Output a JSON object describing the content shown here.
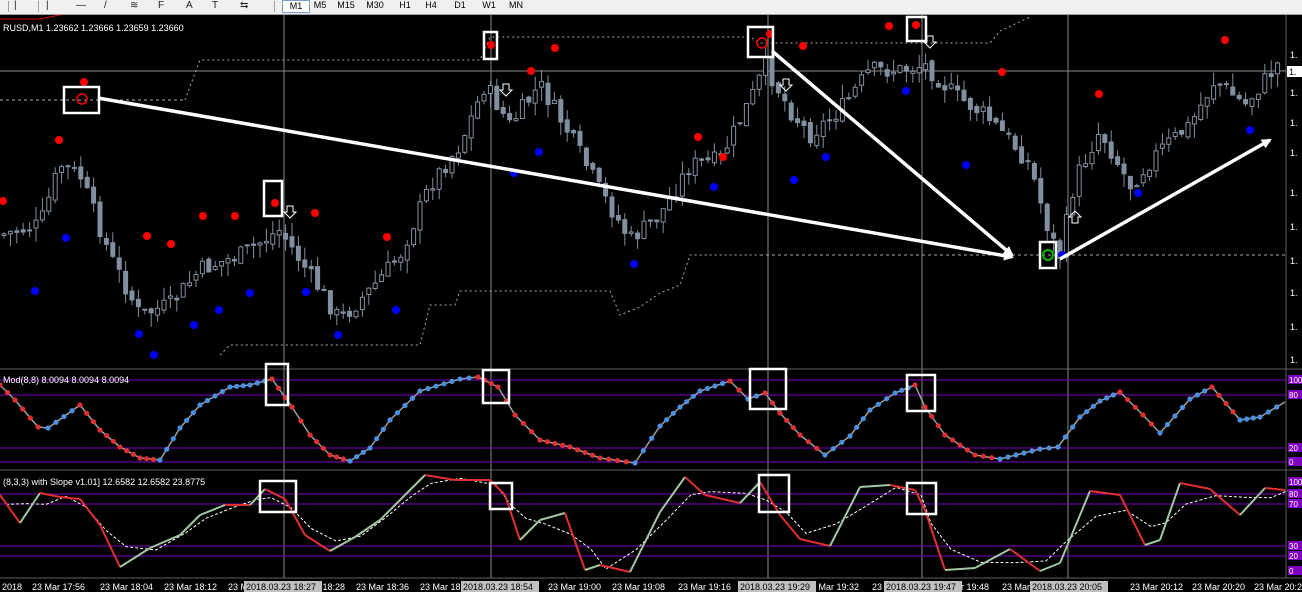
{
  "toolbar": {
    "tools": [
      {
        "name": "cursor-tool",
        "glyph": "|"
      },
      {
        "name": "vertical-line-tool",
        "glyph": "|"
      },
      {
        "name": "horizontal-line-tool",
        "glyph": "—"
      },
      {
        "name": "trendline-tool",
        "glyph": "/"
      },
      {
        "name": "channel-tool",
        "glyph": "≋"
      },
      {
        "name": "fibonacci-tool",
        "glyph": "F"
      },
      {
        "name": "text-tool",
        "glyph": "A"
      },
      {
        "name": "text-label-tool",
        "glyph": "T"
      },
      {
        "name": "arrows-tool",
        "glyph": "⇆"
      }
    ],
    "timeframes": [
      "M1",
      "M5",
      "M15",
      "M30",
      "H1",
      "H4",
      "D1",
      "W1",
      "MN"
    ],
    "active_timeframe": "M1"
  },
  "main_window": {
    "header": "RUSD,M1  1.23662 1.23666 1.23659 1.23660",
    "price_axis_labels": [
      "1.",
      "1.",
      "1.",
      "1.",
      "1.",
      "1.",
      "1.",
      "1.",
      "1.",
      "1."
    ],
    "current_price_tag": "1."
  },
  "sub_window_1": {
    "header": "Mod(8,8) 8.0094 8.0094 8.0094",
    "levels": [
      "100",
      "80",
      "20",
      "0"
    ]
  },
  "sub_window_2": {
    "header": "(8,3,3) with Slope v1.01] 12.6582 12.6582 23.8775",
    "levels": [
      "100",
      "80",
      "70",
      "30",
      "20",
      "0"
    ]
  },
  "time_axis": {
    "labels": [
      "2018",
      "23 Mar 17:56",
      "23 Mar 18:04",
      "23 Mar 18:12",
      "23 M",
      "23 Mar 18:28",
      "23 Mar 18:36",
      "23 Mar 18",
      "23 Mar 19:00",
      "23 Mar 19:08",
      "23 Mar 19:16",
      "23 Mar 19:32",
      "23 M",
      "23 Mar 19:48",
      "23 Mar",
      "23 Mar 20:12",
      "23 Mar 20:20",
      "23 Mar 20:28"
    ],
    "crosshair_labels": [
      "2018.03.23 18:27",
      "2018.03.23 18:54",
      "2018.03.23 19:29",
      "2018.03.23 19:47",
      "2018.03.23 20:05"
    ]
  },
  "colors": {
    "background": "#000000",
    "candle": "#8090a0",
    "buy_dot": "#0000ff",
    "sell_dot": "#ff0000",
    "osc_up": "#4a90e2",
    "osc_down": "#e03030",
    "level_line": "#8000c0",
    "stoch_main": "#a0c8a0",
    "stoch_signal": "#ffffff",
    "annotation": "#ffffff",
    "channel": "#909090",
    "signal_circle_green": "#00c000"
  }
}
